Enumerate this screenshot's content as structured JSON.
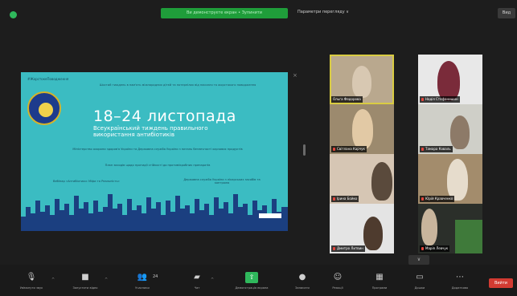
{
  "topbar": {
    "share_banner": "Ви демонструєте екран • Зупинити",
    "view_options": "Параметри перегляду ∨",
    "view_button": "Вид"
  },
  "slide": {
    "hashtag": "#ЖорстокеПоводження",
    "line1": "Шостий тиждень в пам'ять міжнародних дітей та потерпілих від насилля та жорстокого поводження",
    "title": "18–24 листопада",
    "subtitle": "Всеукраїнський тиждень правильного використання антибіотиків",
    "text2": "Міністерство охорони здоров'я України та Державна служба України з питань безпечності харчових продуктів",
    "text3": "План заходів щодо протидії стійкості до протимікробних препаратів",
    "text4": "Вебінар «Антибіотики: Міфи та Реальність»",
    "text5": "Державна служба України з лікарських засобів та контролю"
  },
  "gallery": {
    "tiles": [
      {
        "name": "Ольга Федорова",
        "muted": false,
        "active": true
      },
      {
        "name": "Надія Стефанишин",
        "muted": true,
        "active": false
      },
      {
        "name": "Світлана Карчук",
        "muted": true,
        "active": false
      },
      {
        "name": "Тамара Коваль",
        "muted": true,
        "active": false
      },
      {
        "name": "Ірина Бойко",
        "muted": true,
        "active": false
      },
      {
        "name": "Юрій Кравченко",
        "muted": true,
        "active": false
      },
      {
        "name": "Дмитро Литвин",
        "muted": true,
        "active": false
      },
      {
        "name": "Марія Левчук",
        "muted": true,
        "active": false
      }
    ],
    "more_arrow": "∨"
  },
  "toolbar": {
    "audio": "Увімкнути звук",
    "video": "Запустити відео",
    "participants": "Учасники",
    "participants_count": "24",
    "chat": "Чат",
    "share": "Демонстрація екрана",
    "record": "Записати",
    "reactions": "Реакції",
    "apps": "Програми",
    "whiteboards": "Дошки",
    "more": "Додатково",
    "leave": "Вийти"
  },
  "colors": {
    "slide_bg": "#3bbcc2",
    "skyline": "#1b3f80",
    "share_green": "#1f9d3a",
    "leave_red": "#d33b32",
    "active_speaker": "#d9cc42"
  }
}
